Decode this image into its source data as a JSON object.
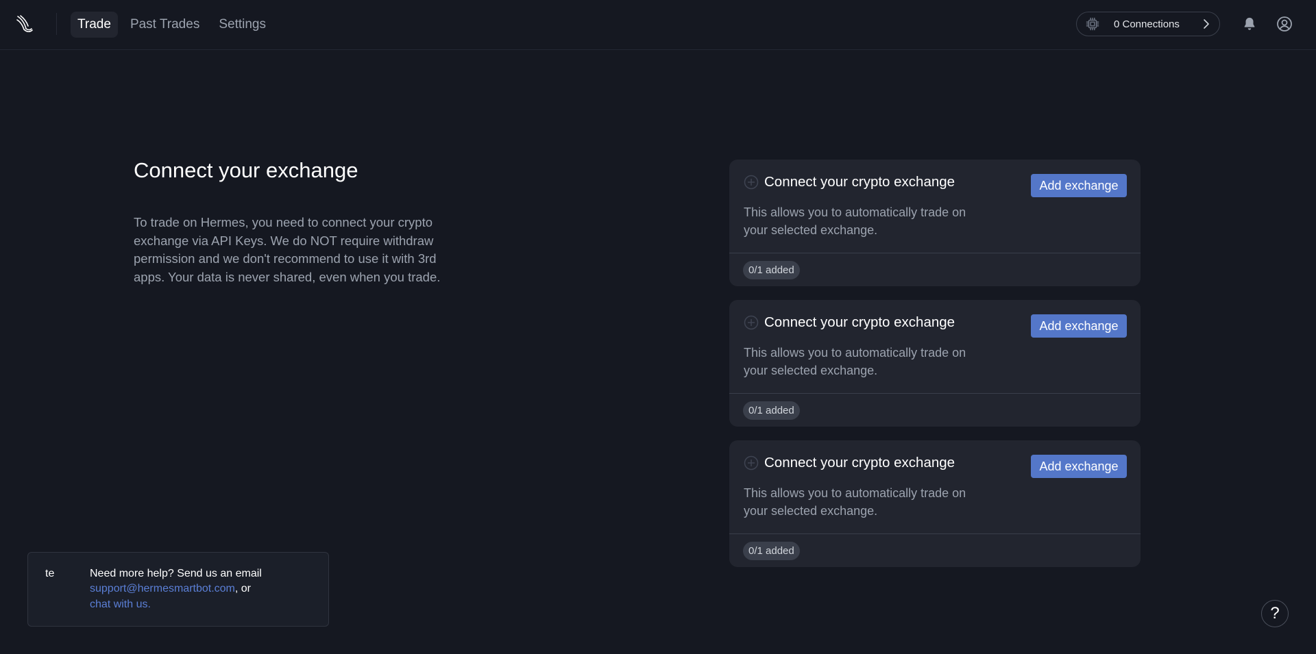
{
  "nav": {
    "items": [
      {
        "label": "Trade",
        "active": true
      },
      {
        "label": "Past Trades",
        "active": false
      },
      {
        "label": "Settings",
        "active": false
      }
    ]
  },
  "connections": {
    "label": "0 Connections",
    "icon": "cpu-chip-icon"
  },
  "intro": {
    "title": "Connect your exchange",
    "text": "To trade on Hermes, you need to connect your crypto exchange via API Keys. We do NOT require withdraw permission and we don't recommend to use it with 3rd apps. Your data is never shared, even when you trade."
  },
  "cards": [
    {
      "title": "Connect your crypto exchange",
      "description": "This allows you to automatically trade on your selected exchange.",
      "button": "Add exchange",
      "badge": "0/1 added"
    },
    {
      "title": "Connect your crypto exchange",
      "description": "This allows you to automatically trade on your selected exchange.",
      "button": "Add exchange",
      "badge": "0/1 added"
    },
    {
      "title": "Connect your crypto exchange",
      "description": "This allows you to automatically trade on your selected exchange.",
      "button": "Add exchange",
      "badge": "0/1 added"
    }
  ],
  "help": {
    "prefix": "te",
    "line1": "Need more help? Send us an email",
    "email": "support@hermesmartbot.com",
    "or_text": ", or",
    "chat": "chat with us."
  },
  "fab": {
    "label": "?"
  },
  "colors": {
    "background": "#151821",
    "card": "#22252f",
    "accent": "#5477c9",
    "link": "#5b7fd6"
  }
}
